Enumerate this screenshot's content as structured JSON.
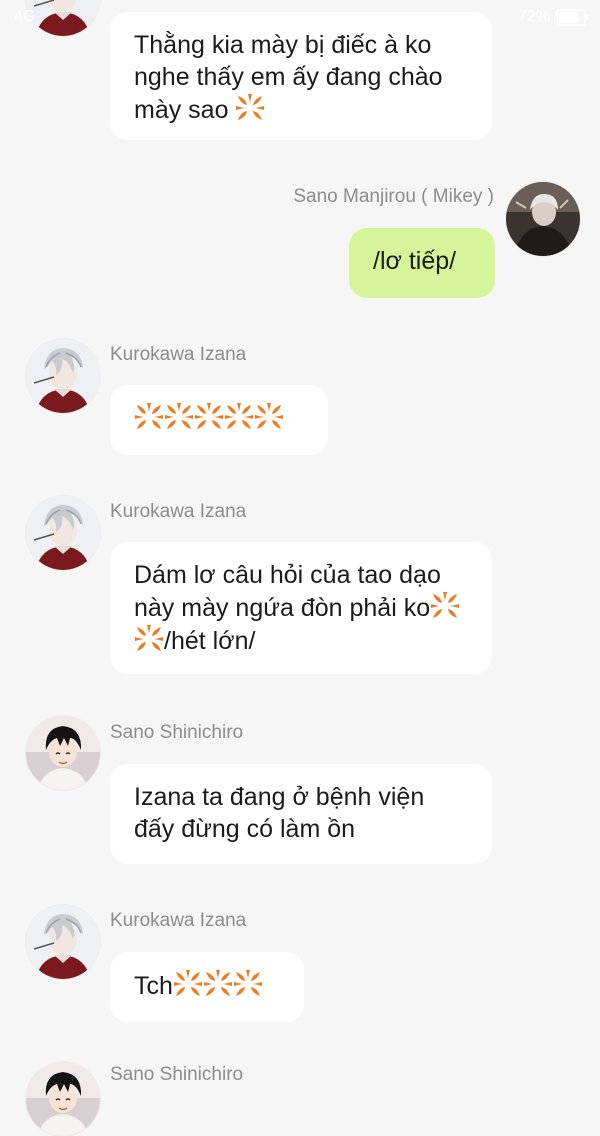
{
  "status_bar": {
    "network": "4G",
    "battery": "72%",
    "battery_level": 0.72
  },
  "colors": {
    "background": "#f6f6f6",
    "bubble_other": "#ffffff",
    "bubble_self": "#d6f59a",
    "anger_emoji": "#f07a1c"
  },
  "messages": [
    {
      "sender": "",
      "text": "Thằng kia mày bị điếc à ko nghe thấy em ấy đang chào mày sao",
      "emoji": [
        "anger-symbol"
      ]
    },
    {
      "sender": "Sano Manjirou ( Mikey )",
      "text": "/lơ tiếp/",
      "self": true
    },
    {
      "sender": "Kurokawa Izana",
      "text": "",
      "emoji": [
        "anger-symbol",
        "anger-symbol",
        "anger-symbol",
        "anger-symbol",
        "anger-symbol"
      ]
    },
    {
      "sender": "Kurokawa Izana",
      "text_before": "Dám lơ câu hỏi của tao dạo này mày ngứa đòn phải ko",
      "emoji": [
        "anger-symbol",
        "anger-symbol"
      ],
      "text_after": "/hét lớn/"
    },
    {
      "sender": "Sano Shinichiro",
      "text": "Izana ta đang ở bệnh viện đấy đừng có làm ồn"
    },
    {
      "sender": "Kurokawa Izana",
      "text": "Tch",
      "emoji": [
        "anger-symbol",
        "anger-symbol",
        "anger-symbol"
      ]
    },
    {
      "sender": "Sano Shinichiro",
      "text": "",
      "partial": true
    }
  ]
}
